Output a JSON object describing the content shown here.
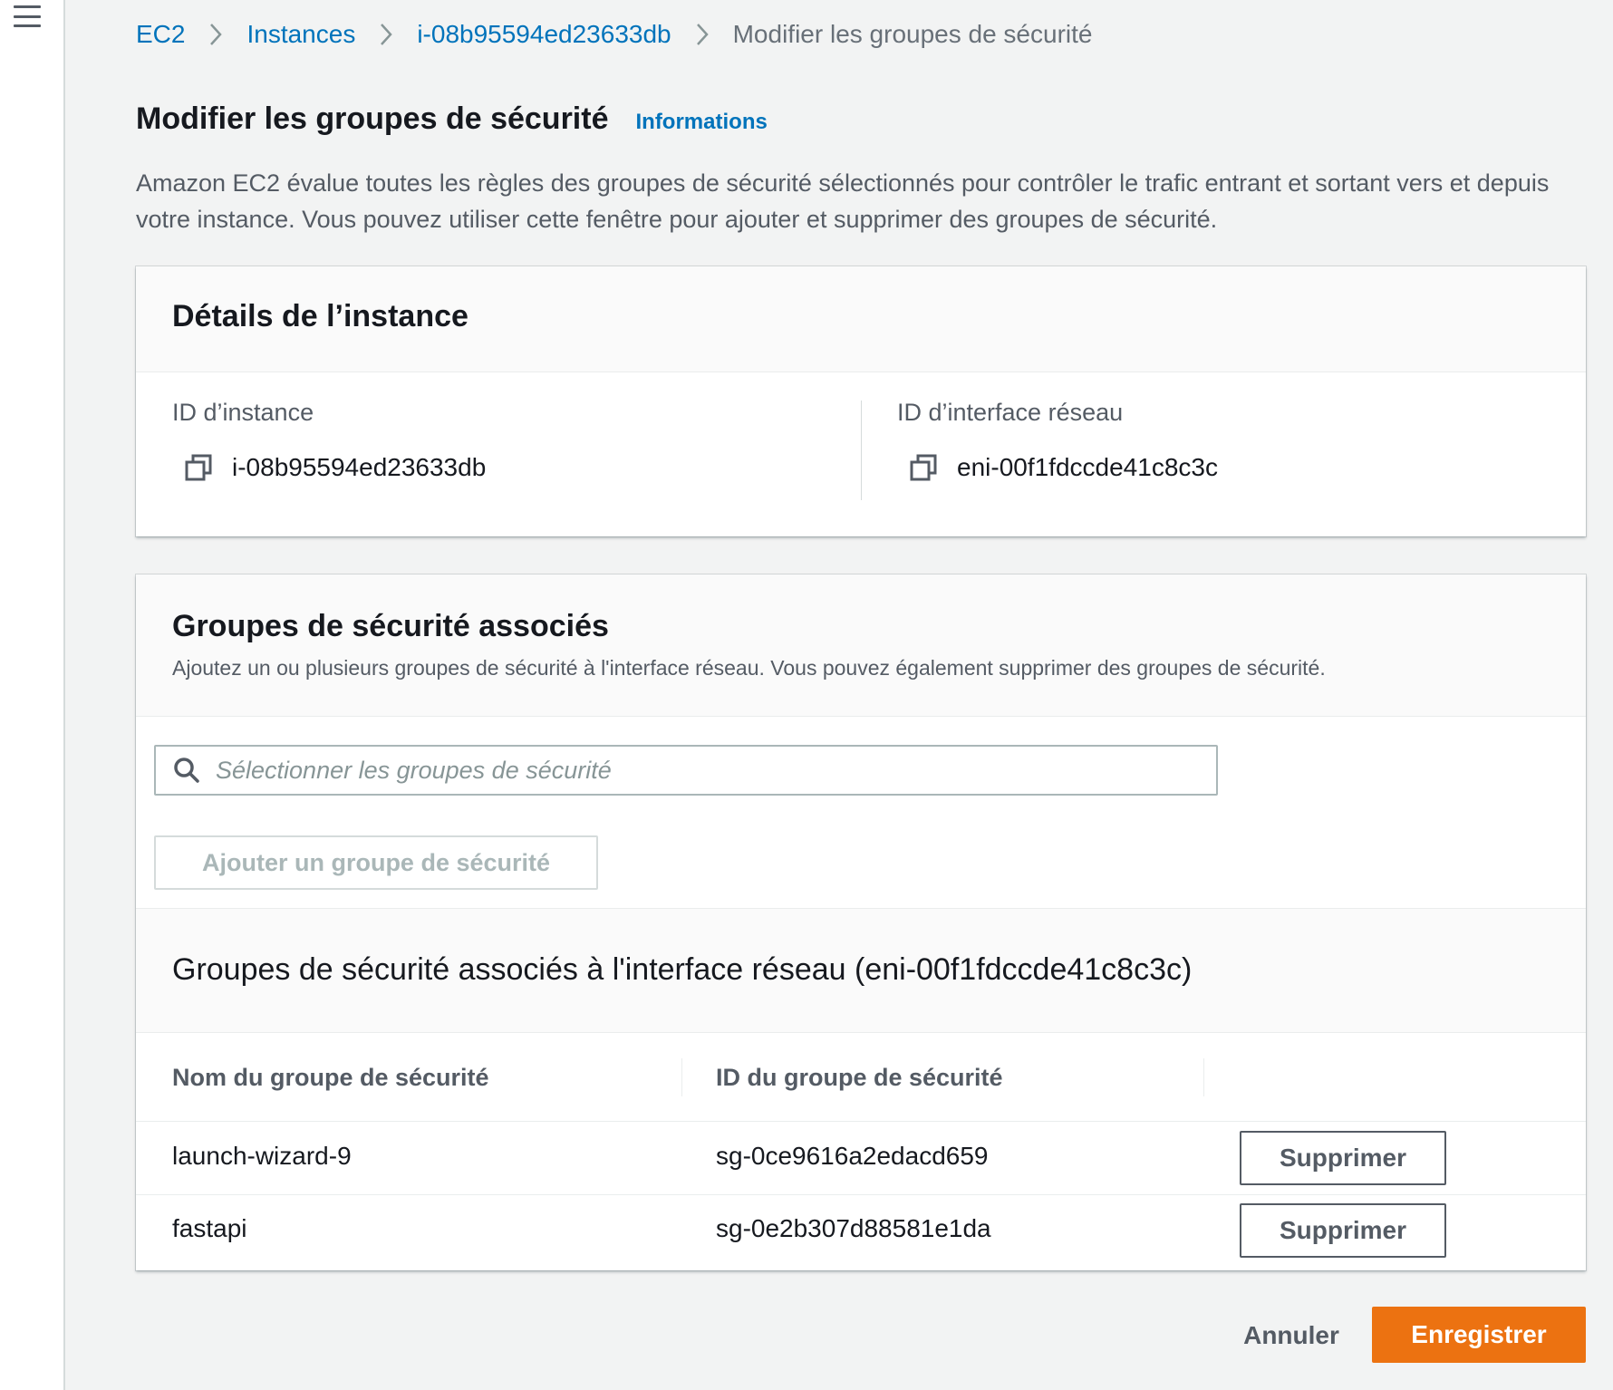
{
  "breadcrumb": {
    "items": [
      {
        "label": "EC2"
      },
      {
        "label": "Instances"
      },
      {
        "label": "i-08b95594ed23633db"
      },
      {
        "label": "Modifier les groupes de sécurité"
      }
    ]
  },
  "page": {
    "title": "Modifier les groupes de sécurité",
    "info_link": "Informations",
    "description": "Amazon EC2 évalue toutes les règles des groupes de sécurité sélectionnés pour contrôler le trafic entrant et sortant vers et depuis votre instance. Vous pouvez utiliser cette fenêtre pour ajouter et supprimer des groupes de sécurité."
  },
  "instance_details": {
    "title": "Détails de l’instance",
    "instance_id_label": "ID d’instance",
    "instance_id": "i-08b95594ed23633db",
    "eni_label": "ID d’interface réseau",
    "eni_id": "eni-00f1fdccde41c8c3c"
  },
  "security_groups": {
    "title": "Groupes de sécurité associés",
    "subtitle": "Ajoutez un ou plusieurs groupes de sécurité à l'interface réseau. Vous pouvez également supprimer des groupes de sécurité.",
    "search_placeholder": "Sélectionner les groupes de sécurité",
    "add_button": "Ajouter un groupe de sécurité",
    "table_title": "Groupes de sécurité associés à l'interface réseau (eni-00f1fdccde41c8c3c)",
    "columns": [
      "Nom du groupe de sécurité",
      "ID du groupe de sécurité"
    ],
    "rows": [
      {
        "name": "launch-wizard-9",
        "id": "sg-0ce9616a2edacd659",
        "action": "Supprimer"
      },
      {
        "name": "fastapi",
        "id": "sg-0e2b307d88581e1da",
        "action": "Supprimer"
      }
    ]
  },
  "footer": {
    "cancel": "Annuler",
    "save": "Enregistrer"
  },
  "colors": {
    "link": "#0073bb",
    "primary_button": "#ec7211",
    "background": "#f2f3f3"
  }
}
